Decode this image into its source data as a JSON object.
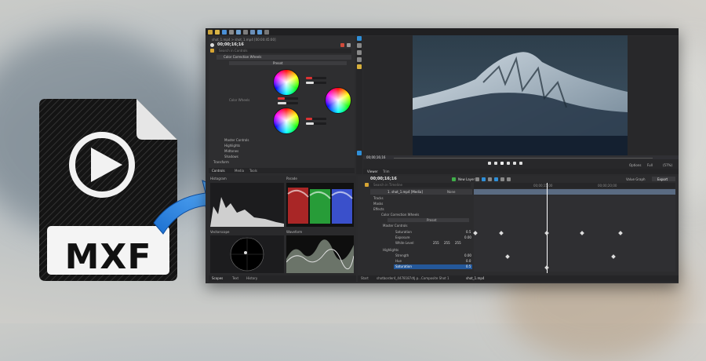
{
  "badge": {
    "text": "MXF"
  },
  "app": {
    "clip_path": "shot_1.mp4 > shot_1.mp4 [00:00:45:00]",
    "timecode_left": "00;00;16;16",
    "search_placeholder": "Search in Controls",
    "effect_name": "Color Correction Wheels",
    "preset_label": "Preset",
    "color_wheels_label": "Color Wheels",
    "master_controls": "Master Controls",
    "highlights": "Highlights",
    "midtones": "Midtones",
    "shadows": "Shadows",
    "transform": "Transform",
    "bottom_tabs": [
      "Controls",
      "Media",
      "Tools"
    ],
    "viewer_tabs": [
      "Viewer",
      "Trim"
    ],
    "viewer_time": "00;00;16;16",
    "options_label": "Options",
    "full_label": "Full",
    "zoom_label": "(57%)",
    "timeline_time": "00;00;16;16",
    "new_layer": "New Layer",
    "value_graph": "Value Graph",
    "export_label": "Export",
    "ruler_marks": [
      "00;00;15;00",
      "00;00;20;00"
    ],
    "layer_name": "1. shot_1.mp4 [Media]",
    "blend_mode": "None",
    "timeline_search": "Search in Timeline",
    "tracks": [
      "Tracks",
      "Masks",
      "Effects",
      "Color Correction Wheels",
      "Preset",
      "Master Controls",
      "Saturation",
      "Exposure",
      "White Level",
      "Highlights",
      "Strength",
      "Hue",
      "Saturation"
    ],
    "track_values": [
      "0.5",
      "0.00",
      "255",
      "255",
      "255",
      "0.00",
      "0.0",
      "0.5"
    ],
    "scopes": {
      "histogram": "Histogram",
      "parade": "Parade",
      "vectorscope": "Vectorscope",
      "waveform": "Waveform"
    },
    "scope_tabs": [
      "Scopes",
      "Text",
      "History"
    ],
    "editor_tabs": [
      "Start",
      "shotborder4_4478187dtj.p...",
      "Composite Shot 1",
      "shot_1.mp4"
    ]
  },
  "colors": {
    "accent": "#2f8fd8",
    "keyframe_bar": "#5a6b82",
    "window_bg": "#2b2b2d"
  }
}
